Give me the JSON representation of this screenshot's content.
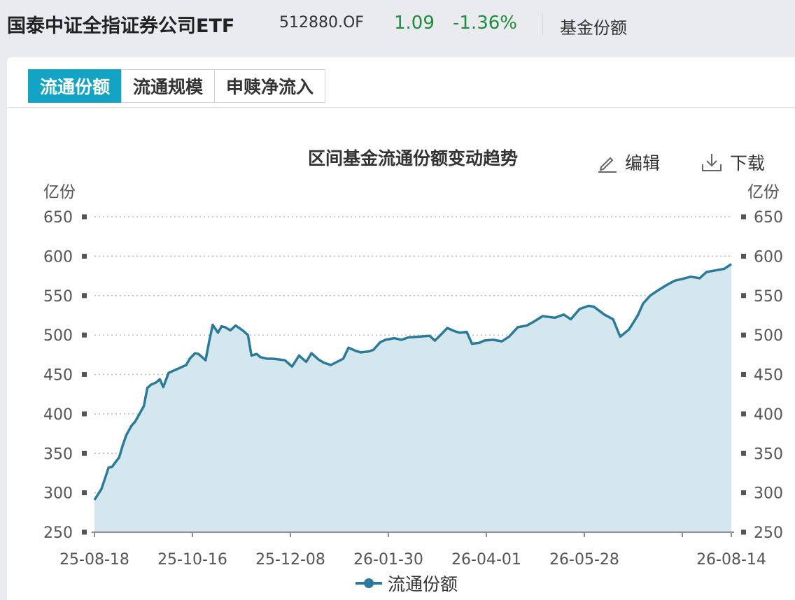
{
  "header": {
    "fund_name": "国泰中证全指证券公司ETF",
    "fund_code": "512880.OF",
    "price": "1.09",
    "change": "-1.36%",
    "section": "基金份额"
  },
  "tabs": [
    {
      "label": "流通份额",
      "active": true
    },
    {
      "label": "流通规模",
      "active": false
    },
    {
      "label": "申赎净流入",
      "active": false
    }
  ],
  "toolbar": {
    "edit_label": "编辑",
    "download_label": "下载"
  },
  "colors": {
    "line": "#2a7a9b",
    "area": "#d4e6ee",
    "accent": "#13a3c5",
    "up_down_green": "#1e8e3e"
  },
  "chart_data": {
    "type": "area",
    "title": "区间基金流通份额变动趋势",
    "ylabel_left": "亿份",
    "ylabel_right": "亿份",
    "ylim": [
      250,
      650
    ],
    "y_ticks": [
      "250",
      "300",
      "350",
      "400",
      "450",
      "500",
      "550",
      "600",
      "650"
    ],
    "x_ticks": [
      "25-08-18",
      "25-10-16",
      "25-12-08",
      "26-01-30",
      "26-04-01",
      "26-05-28",
      "26-08-14"
    ],
    "legend": "流通份额",
    "legend_position": "bottom-center",
    "grid": true,
    "series": [
      {
        "name": "流通份额",
        "x": [
          "25-08-18",
          "25-08-22",
          "25-08-26",
          "25-08-28",
          "25-09-01",
          "25-09-03",
          "25-09-05",
          "25-09-08",
          "25-09-10",
          "25-09-12",
          "25-09-15",
          "25-09-17",
          "25-09-19",
          "25-09-22",
          "25-09-24",
          "25-09-26",
          "25-09-29",
          "25-10-09",
          "25-10-11",
          "25-10-14",
          "25-10-16",
          "25-10-20",
          "25-10-22",
          "25-10-24",
          "25-10-27",
          "25-10-29",
          "25-10-31",
          "25-11-03",
          "25-11-06",
          "25-11-10",
          "25-11-13",
          "25-11-15",
          "25-11-18",
          "25-11-20",
          "25-11-24",
          "25-11-27",
          "25-12-01",
          "25-12-04",
          "25-12-08",
          "25-12-12",
          "25-12-16",
          "25-12-19",
          "25-12-23",
          "25-12-26",
          "25-12-30",
          "26-01-06",
          "26-01-09",
          "26-01-13",
          "26-01-16",
          "26-01-20",
          "26-01-23",
          "26-01-27",
          "26-01-30",
          "26-02-04",
          "26-02-08",
          "26-02-12",
          "26-02-24",
          "26-02-27",
          "26-03-03",
          "26-03-06",
          "26-03-10",
          "26-03-13",
          "26-03-17",
          "26-03-20",
          "26-03-24",
          "26-03-27",
          "26-04-01",
          "26-04-06",
          "26-04-10",
          "26-04-15",
          "26-04-20",
          "26-04-24",
          "26-04-29",
          "26-05-06",
          "26-05-11",
          "26-05-15",
          "26-05-20",
          "26-05-25",
          "26-05-28",
          "26-06-03",
          "26-06-08",
          "26-06-12",
          "26-06-17",
          "26-06-22",
          "26-06-25",
          "26-06-29",
          "26-07-03",
          "26-07-08",
          "26-07-13",
          "26-07-17",
          "26-07-22",
          "26-07-27",
          "26-07-31",
          "26-08-05",
          "26-08-10",
          "26-08-14"
        ],
        "values": [
          291,
          305,
          332,
          333,
          345,
          360,
          373,
          385,
          390,
          398,
          410,
          433,
          437,
          440,
          444,
          434,
          452,
          462,
          470,
          477,
          476,
          468,
          492,
          513,
          503,
          511,
          510,
          506,
          512,
          506,
          500,
          474,
          476,
          472,
          470,
          470,
          469,
          468,
          460,
          474,
          466,
          477,
          469,
          465,
          462,
          470,
          484,
          480,
          478,
          479,
          481,
          491,
          494,
          496,
          494,
          497,
          499,
          493,
          502,
          509,
          505,
          503,
          504,
          489,
          490,
          493,
          494,
          492,
          498,
          510,
          512,
          517,
          524,
          522,
          526,
          520,
          533,
          537,
          536,
          526,
          520,
          498,
          507,
          525,
          540,
          550,
          556,
          563,
          569,
          571,
          574,
          572,
          580,
          582,
          584,
          590
        ]
      }
    ]
  }
}
